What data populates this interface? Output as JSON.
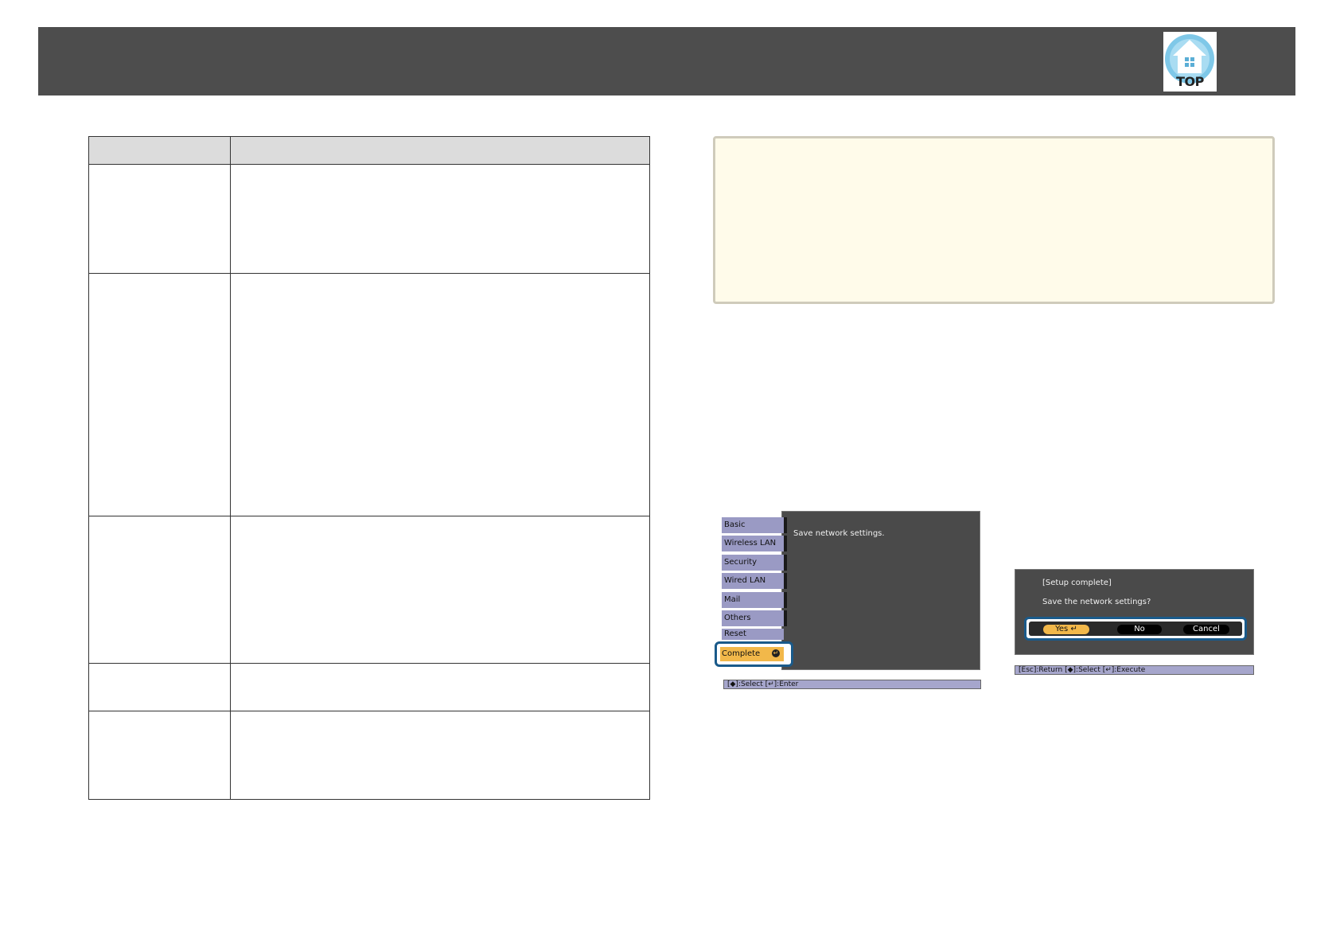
{
  "header": {
    "logo_text": "TOP"
  },
  "menu": {
    "tabs": [
      "Basic",
      "Wireless LAN",
      "Security",
      "Wired LAN",
      "Mail",
      "Others",
      "Reset"
    ],
    "complete_label": "Complete",
    "enter_icon": "enter-icon",
    "message": "Save network settings.",
    "hint": "[◆]:Select  [↵]:Enter"
  },
  "dialog": {
    "title": "[Setup complete]",
    "question": "Save the network settings?",
    "yes_label": "Yes",
    "no_label": "No",
    "cancel_label": "Cancel",
    "hint": "[Esc]:Return  [◆]:Select  [↵]:Execute"
  },
  "colors": {
    "header": "#4d4d4d",
    "tab": "#9a9ac4",
    "highlight": "#f2b84a",
    "focus_frame": "#1a5a8a",
    "note_bg": "#fffbea"
  }
}
